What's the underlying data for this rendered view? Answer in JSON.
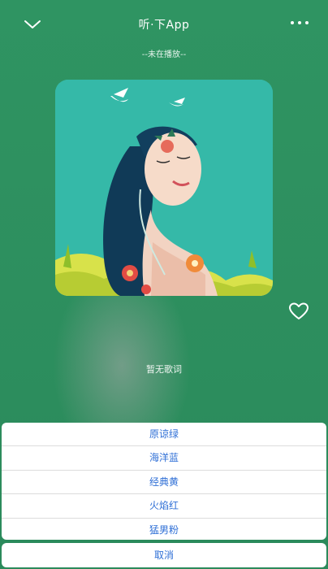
{
  "header": {
    "title": "听·下App",
    "status": "--未在播放--",
    "icons": {
      "back": "chevron-down-icon",
      "more": "more-icon"
    }
  },
  "player": {
    "cover_icon": "album-cover",
    "favorite_icon": "heart-icon",
    "lyrics_placeholder": "暂无歌词"
  },
  "theme_sheet": {
    "options": [
      "原谅绿",
      "海洋蓝",
      "经典黄",
      "火焰红",
      "猛男粉"
    ],
    "cancel_label": "取消"
  },
  "colors": {
    "background": "#2e8f5f",
    "sheet_text": "#2f6fd6",
    "cover_bg": "#34b8a6"
  }
}
